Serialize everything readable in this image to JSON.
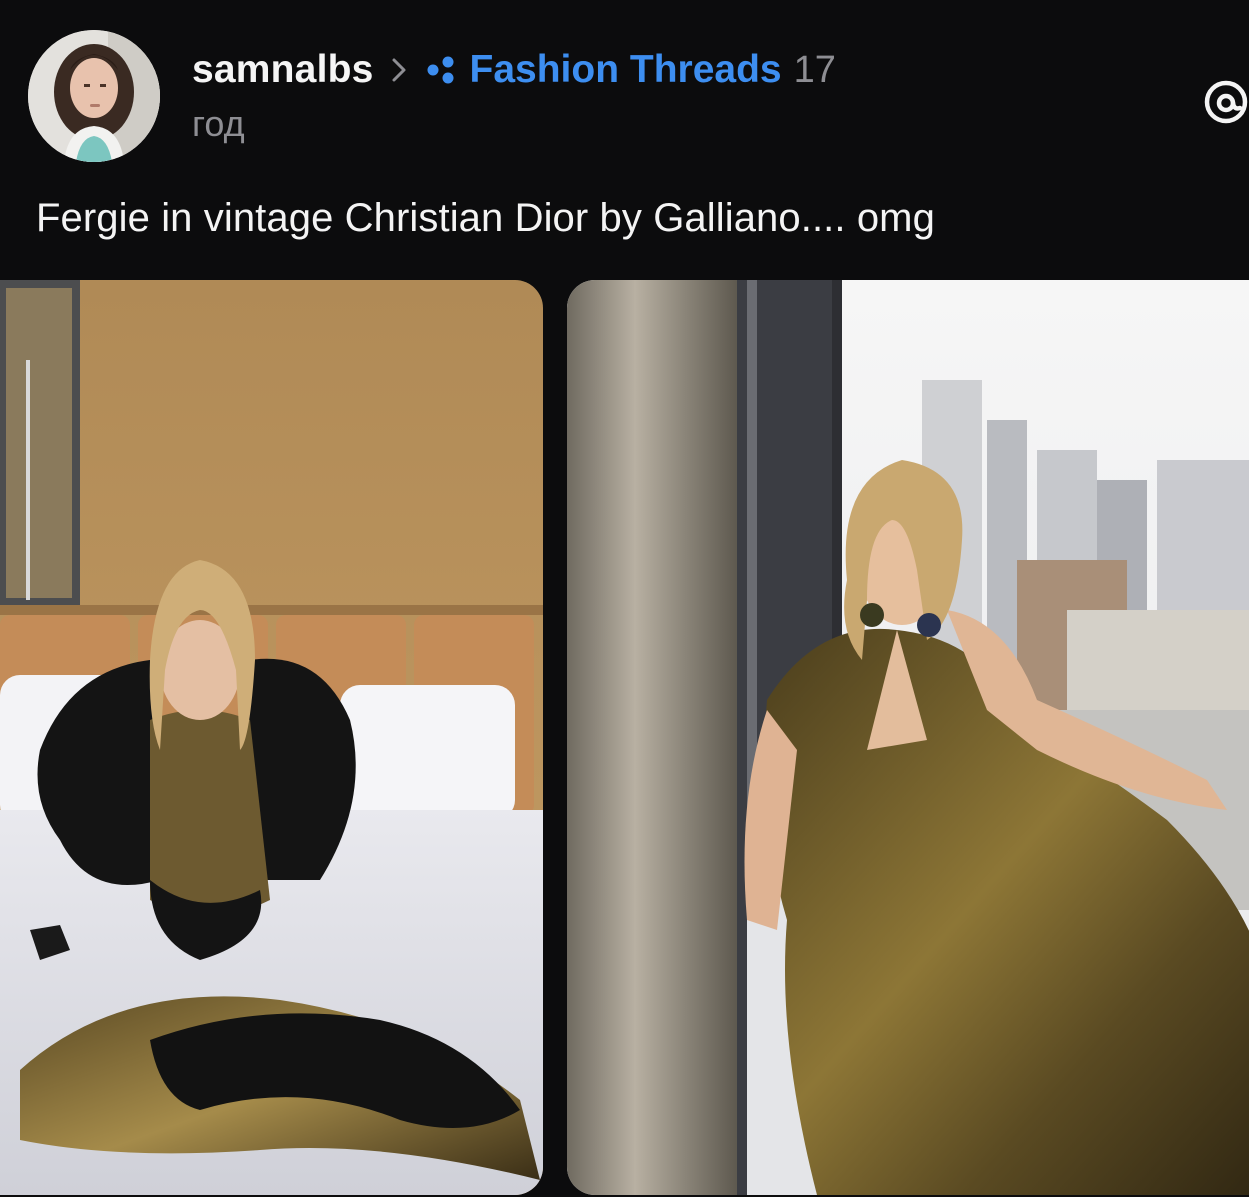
{
  "post": {
    "author": {
      "username": "samnalbs",
      "avatar_icon": "profile-photo"
    },
    "separator_icon": "chevron-right-icon",
    "community": {
      "icon": "community-dots-icon",
      "name": "Fashion Threads",
      "color": "#3d8ef0"
    },
    "timestamp": {
      "value": "17",
      "unit": "год"
    },
    "brand_icon": "threads-logo-icon",
    "text": "Fergie in vintage Christian Dior by Galliano.... omg",
    "media": [
      {
        "kind": "photo",
        "subject": "woman in sequin gown with black feather boa sitting on bed"
      },
      {
        "kind": "photo",
        "subject": "woman in gold sequin gown seated by window over city skyline"
      }
    ]
  },
  "colors": {
    "background": "#0c0c0d",
    "text_primary": "#f4f4f4",
    "text_secondary": "#8e8e93",
    "accent": "#3d8ef0"
  }
}
